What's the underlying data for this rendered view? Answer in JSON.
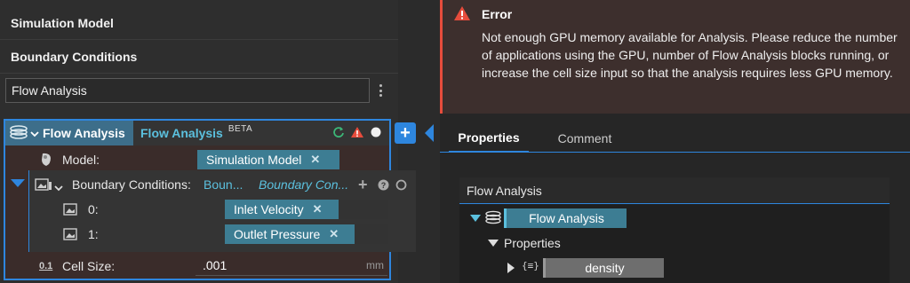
{
  "sections": {
    "simulation_model": "Simulation Model",
    "boundary_conditions": "Boundary Conditions",
    "flow_analysis_field": "Flow Analysis"
  },
  "node": {
    "type_label": "Flow Analysis",
    "name_label": "Flow Analysis",
    "beta_badge": "BETA",
    "model_label": "Model:",
    "model_value": "Simulation Model",
    "bc_label": "Boundary Conditions:",
    "bc_short": "Boun...",
    "bc_placeholder": "Boundary Con...",
    "bc_items": [
      {
        "index": "0:",
        "value": "Inlet Velocity"
      },
      {
        "index": "1:",
        "value": "Outlet Pressure"
      }
    ],
    "cell_size_icon": "0.1",
    "cell_size_label": "Cell Size:",
    "cell_size_value": ".001",
    "cell_size_unit": "mm"
  },
  "error": {
    "title": "Error",
    "message": "Not enough GPU memory available for Analysis. Please reduce the number of applications using the GPU, number of Flow Analysis blocks running, or increase the cell size input so that the analysis requires less GPU memory."
  },
  "tabs": {
    "properties": "Properties",
    "comment": "Comment"
  },
  "tree": {
    "title": "Flow Analysis",
    "root": "Flow Analysis",
    "properties": "Properties",
    "density": "density"
  },
  "colors": {
    "accent": "#2e86de",
    "chip": "#3d7d93",
    "error": "#e74c3c"
  }
}
